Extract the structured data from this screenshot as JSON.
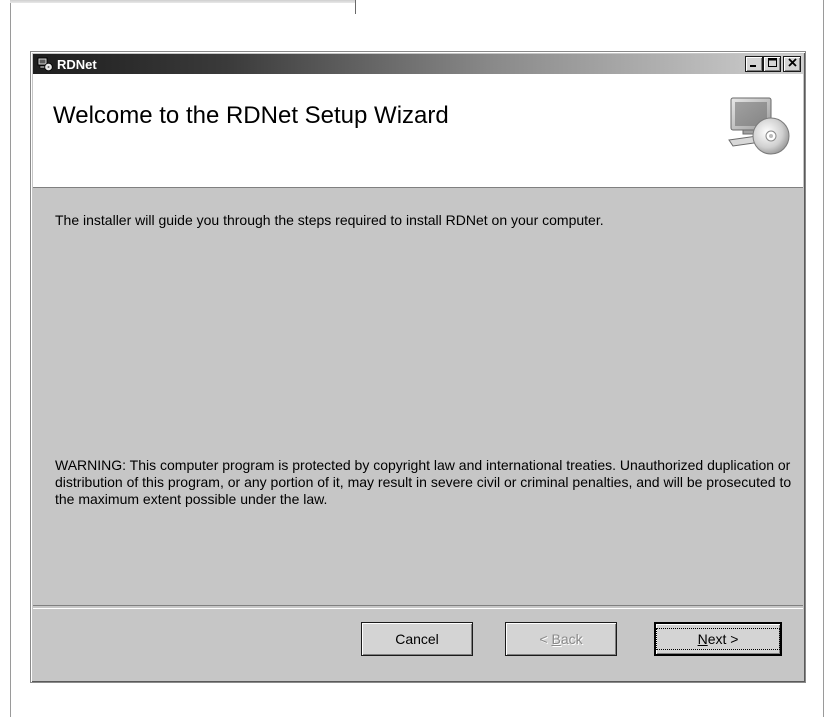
{
  "window": {
    "title": "RDNet",
    "controls": {
      "minimize": "_",
      "maximize": "□",
      "close": "✕"
    }
  },
  "banner": {
    "title": "Welcome to the RDNet Setup Wizard",
    "icon": "computer-cd-icon"
  },
  "body": {
    "intro": "The installer will guide you through the steps required to install RDNet on your computer.",
    "warning": "WARNING: This computer program is protected by copyright law and international treaties. Unauthorized duplication or distribution of this program, or any portion of it, may result in severe civil or criminal penalties, and will be prosecuted to the maximum extent possible under the law."
  },
  "buttons": {
    "cancel": "Cancel",
    "back_prefix": "< ",
    "back_mnemonic": "B",
    "back_rest": "ack",
    "next_mnemonic": "N",
    "next_rest": "ext >"
  },
  "colors": {
    "dialog_bg": "#c6c6c6",
    "banner_bg": "#ffffff",
    "titlebar_start": "#1e1e1e",
    "titlebar_end": "#d0d0d0"
  }
}
